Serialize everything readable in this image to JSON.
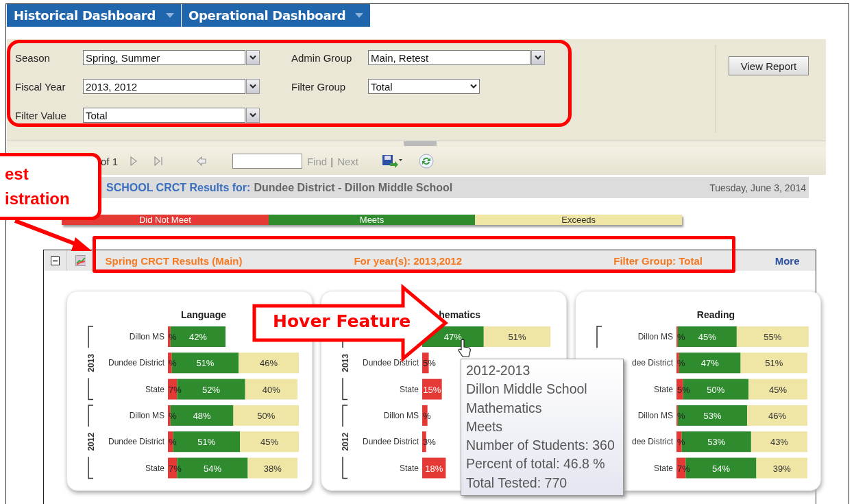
{
  "tabs": [
    {
      "label": "Historical Dashboard"
    },
    {
      "label": "Operational Dashboard"
    }
  ],
  "filters": [
    {
      "label": "Season",
      "value": "Spring, Summer",
      "kind": "combo"
    },
    {
      "label": "Admin Group",
      "value": "Main, Retest",
      "kind": "combo"
    },
    {
      "label": "Fiscal Year",
      "value": "2013, 2012",
      "kind": "combo"
    },
    {
      "label": "Filter Group",
      "value": "Total",
      "kind": "select"
    },
    {
      "label": "Filter Value",
      "value": "Total",
      "kind": "combo"
    }
  ],
  "view_report_button": "View Report",
  "toolbar": {
    "page_text": "of 1",
    "find_label": "Find",
    "separator": "|",
    "next_label": "Next"
  },
  "report_header": {
    "title_prefix": "SCHOOL CRCT Results for:",
    "title_subject": "Dundee District - Dillon Middle School",
    "date": "Tuesday, June 3, 2014"
  },
  "legend": [
    {
      "label": "Did Not Meet",
      "color": "#e53935"
    },
    {
      "label": "Meets",
      "color": "#2e8b2e"
    },
    {
      "label": "Exceeds",
      "color": "#efe6a6"
    }
  ],
  "section": {
    "expanded": true,
    "title": "Spring CRCT Results (Main)",
    "years": "For year(s): 2013,2012",
    "filter_group": "Filter Group: Total",
    "more_link": "More",
    "charts": [
      {
        "year_groups": [
          "2013",
          "2012"
        ],
        "chart_data": {
          "type": "bar",
          "orientation": "horizontal",
          "stacked": true,
          "title": "Language",
          "categories": [
            "Dillon MS",
            "Dundee District",
            "State",
            "Dillon MS",
            "Dundee District",
            "State"
          ],
          "series": [
            {
              "color": "#e53935",
              "values": [
                2,
                3,
                7,
                2,
                4,
                7
              ],
              "value_labels": [
                "%",
                "%",
                "7%",
                "%",
                "%",
                "7%"
              ]
            },
            {
              "color": "#2e8b2e",
              "values": [
                42,
                51,
                52,
                48,
                51,
                54
              ],
              "value_labels": [
                "42%",
                "51%",
                "52%",
                "48%",
                "51%",
                "54%"
              ]
            },
            {
              "color": "#efe6a6",
              "values": [
                null,
                46,
                40,
                50,
                45,
                38
              ],
              "value_labels": [
                null,
                "46%",
                "40%",
                "50%",
                "45%",
                "38%"
              ]
            }
          ]
        }
      },
      {
        "year_groups": [
          "2013",
          "2012"
        ],
        "chart_data": {
          "type": "bar",
          "orientation": "horizontal",
          "stacked": true,
          "title": "hematics",
          "categories": [
            null,
            "Dundee District",
            "State",
            "Dillon MS",
            "Dundee District",
            "State"
          ],
          "series": [
            {
              "color": "#e53935",
              "values": [
                null,
                5,
                15,
                4,
                3,
                18
              ],
              "value_labels": [
                null,
                "5%",
                "15%",
                "%",
                "3%",
                "18%"
              ]
            },
            {
              "color": "#2e8b2e",
              "values": [
                47,
                null,
                null,
                null,
                null,
                null
              ],
              "value_labels": [
                "47%",
                null,
                null,
                null,
                null,
                null
              ]
            },
            {
              "color": "#efe6a6",
              "values": [
                51,
                null,
                null,
                null,
                null,
                null
              ],
              "value_labels": [
                "51%",
                null,
                null,
                null,
                null,
                null
              ]
            }
          ]
        }
      },
      {
        "chart_data": {
          "type": "bar",
          "orientation": "horizontal",
          "stacked": true,
          "title": "Reading",
          "categories": [
            "Dillon MS",
            "dee District",
            "State",
            "Dillon MS",
            "dee District",
            "State"
          ],
          "series": [
            {
              "color": "#e53935",
              "values": [
                1,
                2,
                5,
                1,
                4,
                7
              ],
              "value_labels": [
                "%",
                "%",
                "5%",
                "%",
                "%",
                "7%"
              ]
            },
            {
              "color": "#2e8b2e",
              "values": [
                45,
                47,
                50,
                53,
                53,
                54
              ],
              "value_labels": [
                "45%",
                "47%",
                "50%",
                "53%",
                "53%",
                "54%"
              ]
            },
            {
              "color": "#efe6a6",
              "values": [
                55,
                51,
                45,
                46,
                43,
                39
              ],
              "value_labels": [
                "55%",
                "51%",
                "45%",
                "46%",
                "43%",
                "39%"
              ]
            }
          ]
        }
      }
    ]
  },
  "tooltip": {
    "lines": [
      "2012-2013",
      "Dillon Middle School",
      "Mathematics",
      "Meets",
      "Number of Students: 360",
      "Percent of total: 46.8 %",
      "Total Tested: 770"
    ]
  },
  "callout": {
    "lines": [
      "est",
      "istration"
    ]
  },
  "hover_arrow": {
    "text": "Hover Feature"
  }
}
